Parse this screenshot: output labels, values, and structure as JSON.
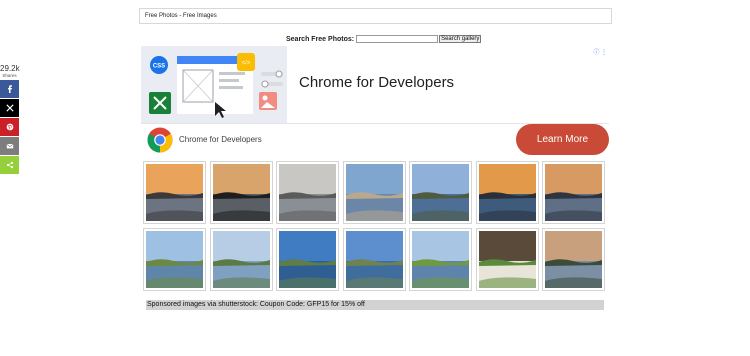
{
  "breadcrumb": {
    "text": "Free Photos - Free Images"
  },
  "search": {
    "label": "Search Free Photos:",
    "value": "",
    "button_label": "Search gallery"
  },
  "share": {
    "count": "29.2k",
    "label": "Shares",
    "buttons": [
      {
        "name": "facebook",
        "icon": "facebook-icon",
        "color": "#3b5998"
      },
      {
        "name": "twitter",
        "icon": "x-icon",
        "color": "#000000"
      },
      {
        "name": "pinterest",
        "icon": "pinterest-icon",
        "color": "#cb2027"
      },
      {
        "name": "email",
        "icon": "email-icon",
        "color": "#7d7d7d"
      },
      {
        "name": "sharethis",
        "icon": "share-icon",
        "color": "#95d03a"
      }
    ]
  },
  "ad": {
    "headline": "Chrome for Developers",
    "advertiser": "Chrome for Developers",
    "cta_label": "Learn More",
    "cta_color": "#c94b37",
    "illustration_badges": [
      "CSS",
      "</>"
    ]
  },
  "gallery": {
    "items": [
      {
        "name": "sunset-pier-over-water",
        "sky": "#e9a35a",
        "water": "#6b7480",
        "land": "#3a3a3a"
      },
      {
        "name": "bridge-silhouette-at-sunset",
        "sky": "#d9a46b",
        "water": "#5a5f66",
        "land": "#1e1e1e"
      },
      {
        "name": "calm-lake-dusk",
        "sky": "#c9c7c4",
        "water": "#8a8f95",
        "land": "#5b5b5b"
      },
      {
        "name": "sandy-shore-blue-sky",
        "sky": "#7fa6cf",
        "water": "#6b86a6",
        "land": "#b7a88e"
      },
      {
        "name": "rocky-shoreline-with-trees",
        "sky": "#8fb1d9",
        "water": "#4d6f96",
        "land": "#4f5a3e"
      },
      {
        "name": "golden-sunset-over-lake",
        "sky": "#e29a4a",
        "water": "#3f5b7c",
        "land": "#2a2f38"
      },
      {
        "name": "sunset-reflection-lake",
        "sky": "#d89a63",
        "water": "#5f6f86",
        "land": "#2e3440"
      },
      {
        "name": "reeds-and-lake-reflection",
        "sky": "#9dc0e3",
        "water": "#5f86a8",
        "land": "#6b8a3f"
      },
      {
        "name": "lake-with-clouds-reflection",
        "sky": "#b7cde6",
        "water": "#7fa0c1",
        "land": "#5c7a44"
      },
      {
        "name": "blue-sky-white-clouds-lake",
        "sky": "#3f7cc2",
        "water": "#2f5f92",
        "land": "#5f7d4a"
      },
      {
        "name": "wide-lake-cloudy-sky",
        "sky": "#5d8fce",
        "water": "#3f6d9d",
        "land": "#6d8452"
      },
      {
        "name": "lakeside-path-green-grass",
        "sky": "#a8c6e4",
        "water": "#5f84ab",
        "land": "#6f9a3f"
      },
      {
        "name": "salad-plate-on-table",
        "sky": "#5a4a3a",
        "water": "#e9e4d8",
        "land": "#5a8b3a"
      },
      {
        "name": "sailboat-sunset-lake",
        "sky": "#c9a07d",
        "water": "#7b8fa5",
        "land": "#3c4b3a"
      }
    ]
  },
  "sponsored": {
    "text": "Sponsored images via shutterstock: Coupon Code: GFP15 for 15% off"
  }
}
